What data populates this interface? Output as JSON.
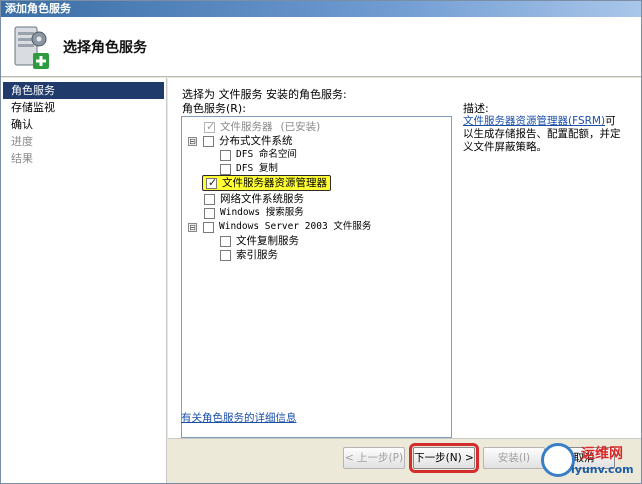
{
  "window": {
    "title": "添加角色服务"
  },
  "header": {
    "title": "选择角色服务"
  },
  "nav": {
    "items": [
      {
        "label": "角色服务",
        "state": "active"
      },
      {
        "label": "存储监视",
        "state": "normal"
      },
      {
        "label": "确认",
        "state": "normal"
      },
      {
        "label": "进度",
        "state": "disabled"
      },
      {
        "label": "结果",
        "state": "disabled"
      }
    ]
  },
  "content": {
    "prompt": "选择为 文件服务 安装的角色服务:",
    "list_label": "角色服务(R):",
    "tree": [
      {
        "label": "文件服务器",
        "suffix": "(已安装)",
        "checked": true,
        "disabled": true
      },
      {
        "label": "分布式文件系统",
        "expander": "⊟",
        "checked": false
      },
      {
        "label": "DFS 命名空间",
        "checked": false
      },
      {
        "label": "DFS 复制",
        "checked": false
      },
      {
        "label": "文件服务器资源管理器",
        "checked": true,
        "highlight": true
      },
      {
        "label": "网络文件系统服务",
        "checked": false
      },
      {
        "label": "Windows 搜索服务",
        "checked": false
      },
      {
        "label": "Windows Server 2003 文件服务",
        "expander": "⊟",
        "checked": false
      },
      {
        "label": "文件复制服务",
        "checked": false
      },
      {
        "label": "索引服务",
        "checked": false
      }
    ],
    "description": {
      "label": "描述:",
      "link": "文件服务器资源管理器(FSRM)",
      "text": "可以生成存储报告、配置配额，并定义文件屏蔽策略。"
    },
    "help_link": "有关角色服务的详细信息"
  },
  "footer": {
    "prev": "< 上一步(P)",
    "next": "下一步(N) >",
    "install": "安装(I)",
    "cancel": "取消"
  },
  "watermark": {
    "name": "运维网",
    "url": "iyunv.com"
  },
  "colors": {
    "nav_active": "#1f3a6b",
    "highlight": "#ffff33",
    "callout": "#d22c2c",
    "link": "#1a4fa8"
  }
}
